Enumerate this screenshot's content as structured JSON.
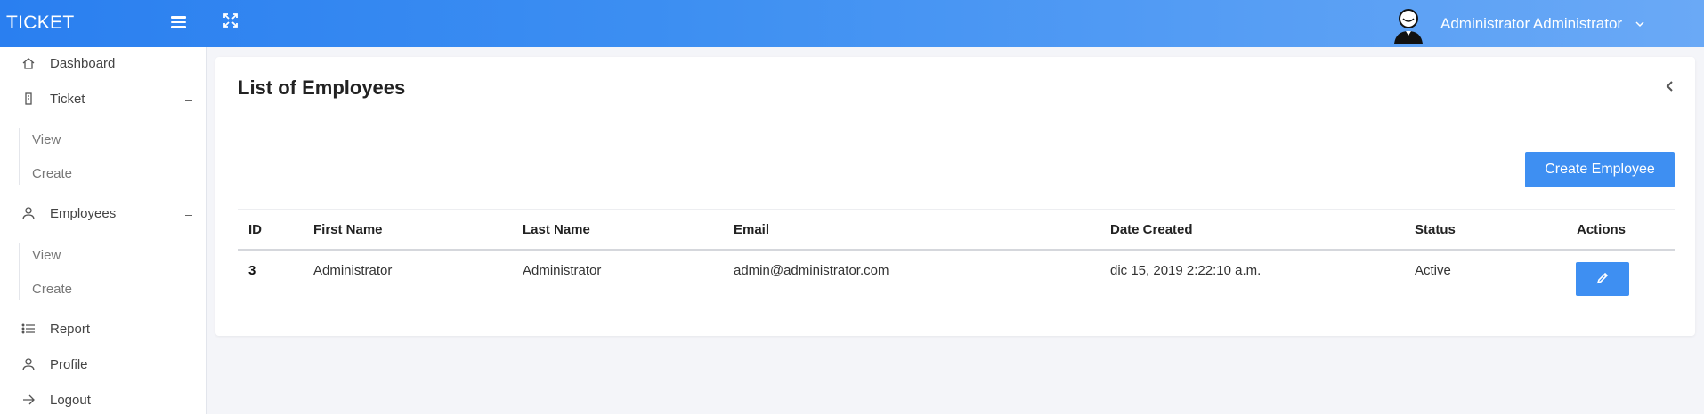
{
  "app": {
    "brand": "TICKET"
  },
  "header": {
    "user_name": "Administrator Administrator"
  },
  "sidebar": {
    "items": [
      {
        "label": "Dashboard"
      },
      {
        "label": "Ticket"
      },
      {
        "label": "Employees"
      },
      {
        "label": "Report"
      },
      {
        "label": "Profile"
      },
      {
        "label": "Logout"
      }
    ],
    "ticket_sub": [
      {
        "label": "View"
      },
      {
        "label": "Create"
      }
    ],
    "employees_sub": [
      {
        "label": "View"
      },
      {
        "label": "Create"
      }
    ]
  },
  "main": {
    "title": "List of Employees",
    "create_button": "Create Employee",
    "table": {
      "columns": [
        "ID",
        "First Name",
        "Last Name",
        "Email",
        "Date Created",
        "Status",
        "Actions"
      ],
      "rows": [
        [
          "3",
          "Administrator",
          "Administrator",
          "admin@administrator.com",
          "dic 15, 2019 2:22:10 a.m.",
          "Active"
        ]
      ]
    }
  },
  "icons": {
    "menu": "hamburger-icon",
    "fullscreen": "expand-icon",
    "avatar": "user-avatar-icon",
    "caret": "chevron-down-icon",
    "collapse": "chevron-left-icon",
    "edit": "pencil-icon"
  },
  "colors": {
    "accent": "#3e8ff2",
    "header_start": "#2a7ff0",
    "header_end": "#6aa9f6"
  }
}
